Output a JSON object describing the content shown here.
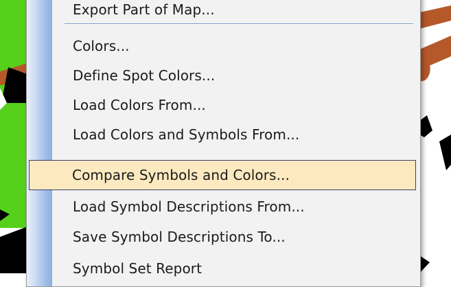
{
  "colors": {
    "map_green": "#55d11b",
    "map_brown": "#b5582a",
    "map_black": "#000000",
    "menu_bg": "#f2f2f2",
    "menu_highlight_bg": "#fde9bf",
    "menu_highlight_border": "#3c3c6e",
    "gutter_blue": "#9fbde8"
  },
  "menu": {
    "items": [
      {
        "label": "Export Part of Map...",
        "state": "partially-visible"
      },
      {
        "label": "Colors..."
      },
      {
        "label": "Define Spot Colors..."
      },
      {
        "label": "Load Colors From..."
      },
      {
        "label": "Load Colors and Symbols From..."
      },
      {
        "label": "Compare Symbols and Colors...",
        "state": "highlighted"
      },
      {
        "label": "Load Symbol Descriptions From..."
      },
      {
        "label": "Save Symbol Descriptions To..."
      },
      {
        "label": "Symbol Set Report",
        "state": "partially-visible"
      }
    ]
  }
}
